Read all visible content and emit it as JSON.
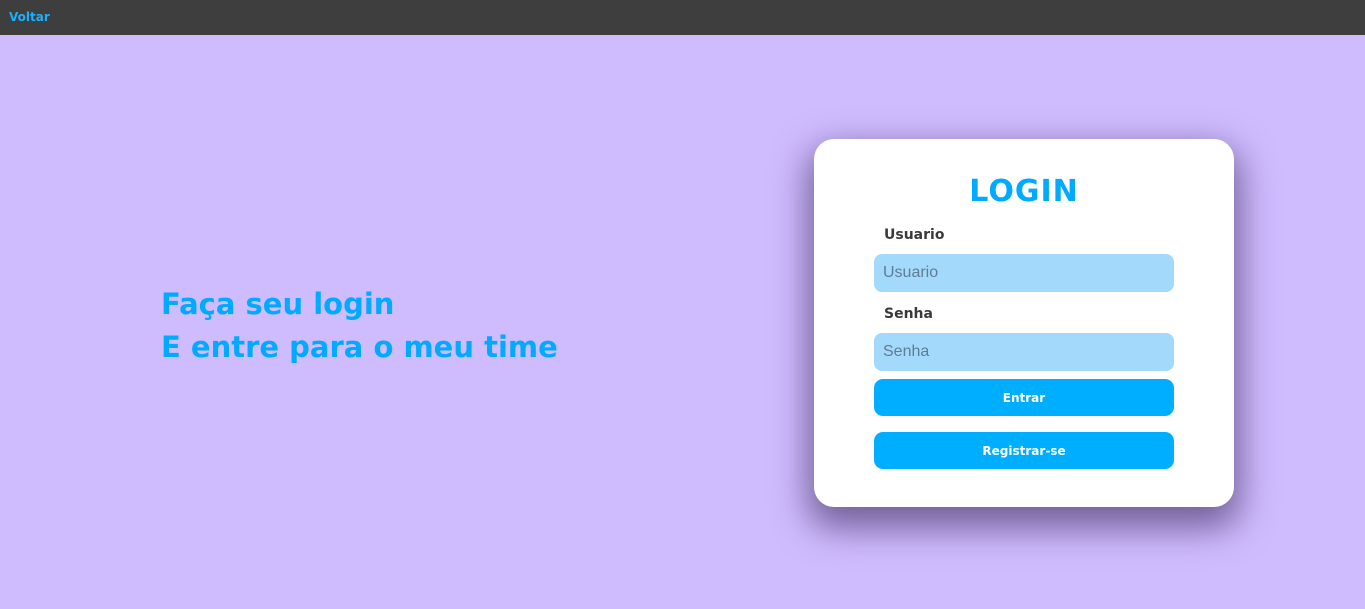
{
  "nav": {
    "back_label": "Voltar"
  },
  "hero": {
    "line1": "Faça seu login",
    "line2": "E entre para o meu time"
  },
  "login": {
    "title": "LOGIN",
    "username_label": "Usuario",
    "username_placeholder": "Usuario",
    "username_value": "",
    "password_label": "Senha",
    "password_placeholder": "Senha",
    "password_value": "",
    "submit_label": "Entrar",
    "register_label": "Registrar-se"
  },
  "colors": {
    "background": "#cfbcff",
    "topbar": "#3e3e3e",
    "accent": "#00aaff",
    "input_bg": "#a3dafc",
    "card_bg": "#ffffff"
  }
}
